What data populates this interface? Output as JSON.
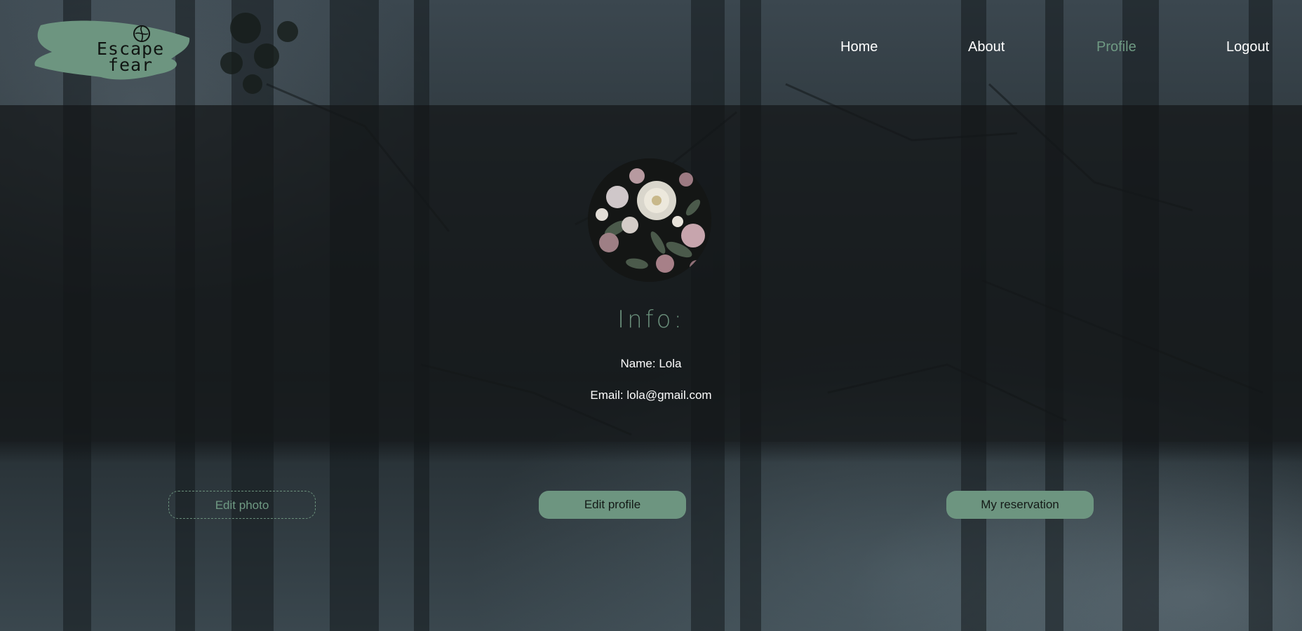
{
  "header": {
    "logo_text_line1": "Escape",
    "logo_text_line2": "fear",
    "nav": [
      {
        "label": "Home",
        "active": false
      },
      {
        "label": "About",
        "active": false
      },
      {
        "label": "Profile",
        "active": true
      },
      {
        "label": "Logout",
        "active": false
      }
    ]
  },
  "profile": {
    "avatar_icon": "floral-avatar-image",
    "info_title": "Info:",
    "name_line": "Name: Lola",
    "email_line": "Email: lola@gmail.com"
  },
  "actions": {
    "edit_photo_label": "Edit photo",
    "edit_profile_label": "Edit profile",
    "my_reservation_label": "My reservation"
  },
  "colors": {
    "accent": "#6d9580",
    "nav_active": "#6f9a83",
    "text": "#ffffff"
  }
}
